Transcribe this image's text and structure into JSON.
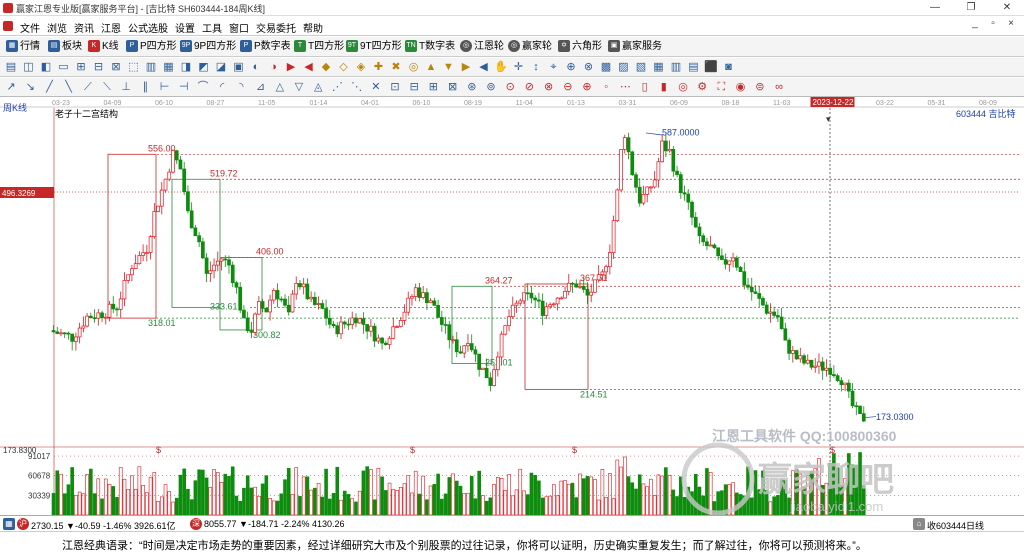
{
  "window": {
    "title": "赢家江恩专业版[赢家服务平台] - [吉比特  SH603444-184周K线]",
    "buttons": [
      "—",
      "❐",
      "✕"
    ]
  },
  "menu": {
    "items": [
      "文件",
      "浏览",
      "资讯",
      "江恩",
      "公式选股",
      "设置",
      "工具",
      "窗口",
      "交易委托",
      "帮助"
    ],
    "mdi_buttons": [
      "_",
      "▫",
      "×"
    ]
  },
  "toolbar1": {
    "items": [
      {
        "icon": "▦",
        "label": "行情"
      },
      {
        "icon": "▤",
        "label": "板块"
      },
      {
        "icon": "K",
        "label": "K线"
      },
      {
        "icon": "P",
        "label": "P四方形"
      },
      {
        "icon": "9P",
        "label": "9P四方形"
      },
      {
        "icon": "P",
        "label": "P数字表"
      },
      {
        "icon": "T",
        "label": "T四方形"
      },
      {
        "icon": "9T",
        "label": "9T四方形"
      },
      {
        "icon": "TN",
        "label": "T数字表"
      },
      {
        "icon": "◎",
        "label": "江恩轮"
      },
      {
        "icon": "◎",
        "label": "赢家轮"
      },
      {
        "icon": "✡",
        "label": "六角形"
      },
      {
        "icon": "▣",
        "label": "赢家服务"
      }
    ]
  },
  "chart": {
    "period_label": "周K线",
    "study_label": "老子十二宫结构",
    "stock_label": "603444  吉比特",
    "cursor_price": "496.3269",
    "cursor_date": "2023-12-22",
    "date_ticks": [
      "03-23",
      "04-09",
      "06-10",
      "08-27",
      "11-05",
      "01-14",
      "04-01",
      "06-10",
      "08-19",
      "11-04",
      "01-13",
      "03-31",
      "06-09",
      "08-18",
      "11-03",
      "2023-12-22",
      "03-22",
      "05-31",
      "08-09"
    ],
    "price_annotations": [
      "556.00",
      "519.72",
      "406.00",
      "333.61",
      "318.01",
      "300.82",
      "364.27",
      "367.61",
      "252.01",
      "214.51",
      "587.0000",
      "173.0300"
    ],
    "watermark": "江恩工具软件  QQ:100800360",
    "logo_text": "赢家聊吧",
    "logo_url": "jiaoba.yidi1.com",
    "dollar_marks": [
      "$",
      "$",
      "$",
      "$"
    ],
    "volume_axis": [
      "173.8300",
      "91017",
      "60678",
      "30339"
    ]
  },
  "chart_data": {
    "type": "candlestick",
    "title": "老子十二宫结构",
    "period": "周K线",
    "symbol": "603444",
    "name": "吉比特",
    "levels": [
      556.0,
      519.72,
      406.0,
      364.27,
      367.61,
      333.61,
      318.01,
      300.82,
      252.01,
      214.51,
      587.0,
      173.03
    ],
    "cursor_price": 496.3269,
    "cursor_date": "2023-12-22",
    "y_range": [
      170,
      600
    ],
    "volume_ticks": [
      91017,
      60678,
      30339
    ]
  },
  "status": {
    "sh_index": "2730.15 ▼-40.59 -1.46% 3926.61亿",
    "sz_index": "8055.77 ▼-184.71 -2.24% 4130.26",
    "right_text": "收603444日线"
  },
  "quote": "江恩经典语录：“时间是决定市场走势的重要因素，经过详细研究大市及个别股票的过往记录，你将可以证明，历史确实重复发生；而了解过往，你将可以预测将来。”。",
  "colors": {
    "up": "#e0141c",
    "down": "#0d8c0d",
    "bg": "#ffffff",
    "accent": "#c62828"
  }
}
